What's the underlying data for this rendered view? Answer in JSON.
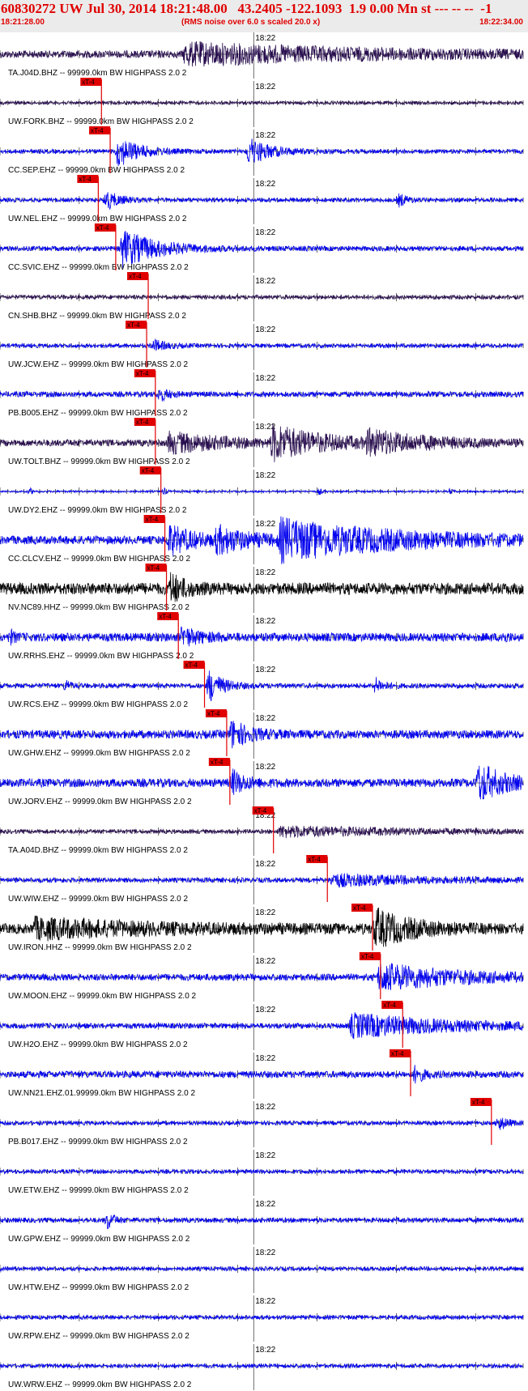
{
  "header": {
    "title": "60830272 UW Jul 30, 2014 18:21:48.00   43.2405 -122.1093  1.9 0.00 Mn st --- -- --  -1",
    "start_time": "18:21:28.00",
    "rms_note": "(RMS noise over 6.0 s scaled 20.0 x)",
    "end_time": "18:22:34.00"
  },
  "colors": {
    "header_text": "#e00000",
    "header_bg": "#ebebeb",
    "pick_marker": "#e00000",
    "trace_blue": "#0000ee",
    "trace_purple": "#2a1050",
    "trace_black": "#000000",
    "grid": "#000000"
  },
  "chart_data": {
    "type": "line",
    "x_unit": "seconds after 18:21:28.00",
    "xlim": [
      0,
      66
    ],
    "minute_mark_label": "18:22",
    "minute_mark_time": 32,
    "pick_label": "xT-4",
    "filter_text": "99999.0km BW  HIGHPASS  2.0  2",
    "grid": "vertical ticks every 1 s, every trace",
    "traces": [
      {
        "label": "TA.J04D.BHZ -- 99999.0km BW  HIGHPASS  2.0  2",
        "color": "purple",
        "pick": null,
        "base": 0.22,
        "bursts": [
          {
            "t": 23,
            "amp": 0.6,
            "dur": 42
          }
        ]
      },
      {
        "label": "UW.FORK.BHZ -- 99999.0km BW  HIGHPASS  2.0  2",
        "color": "purple",
        "pick": 12.8,
        "base": 0.1,
        "bursts": []
      },
      {
        "label": "CC.SEP.EHZ -- 99999.0km BW  HIGHPASS  2.0  2",
        "color": "blue",
        "pick": 13.9,
        "base": 0.12,
        "bursts": [
          {
            "t": 14.5,
            "amp": 1.0,
            "dur": 5
          },
          {
            "t": 31,
            "amp": 0.9,
            "dur": 5
          }
        ]
      },
      {
        "label": "UW.NEL.EHZ -- 99999.0km BW  HIGHPASS  2.0  2",
        "color": "blue",
        "pick": 12.4,
        "base": 0.12,
        "bursts": [
          {
            "t": 13,
            "amp": 0.7,
            "dur": 3
          },
          {
            "t": 50,
            "amp": 0.5,
            "dur": 2
          }
        ]
      },
      {
        "label": "CC.SVIC.EHZ -- 99999.0km BW  HIGHPASS  2.0  2",
        "color": "blue",
        "pick": 14.6,
        "base": 0.14,
        "bursts": [
          {
            "t": 15,
            "amp": 1.2,
            "dur": 8
          }
        ]
      },
      {
        "label": "CN.SHB.BHZ -- 99999.0km BW  HIGHPASS  2.0  2",
        "color": "purple",
        "pick": 18.7,
        "base": 0.12,
        "bursts": []
      },
      {
        "label": "UW.JCW.EHZ -- 99999.0km BW  HIGHPASS  2.0  2",
        "color": "blue",
        "pick": 18.5,
        "base": 0.12,
        "bursts": [
          {
            "t": 19,
            "amp": 0.4,
            "dur": 3
          }
        ]
      },
      {
        "label": "PB.B005.EHZ -- 99999.0km BW  HIGHPASS  2.0  2",
        "color": "blue",
        "pick": 19.6,
        "base": 0.16,
        "bursts": [
          {
            "t": 19.8,
            "amp": 0.5,
            "dur": 2
          }
        ]
      },
      {
        "label": "UW.TOLT.BHZ -- 99999.0km BW  HIGHPASS  2.0  2",
        "color": "purple",
        "pick": 19.6,
        "base": 0.2,
        "bursts": [
          {
            "t": 21,
            "amp": 0.6,
            "dur": 13
          },
          {
            "t": 34,
            "amp": 1.0,
            "dur": 12
          },
          {
            "t": 46,
            "amp": 0.6,
            "dur": 14
          }
        ]
      },
      {
        "label": "UW.DY2.EHZ -- 99999.0km BW  HIGHPASS  2.0  2",
        "color": "blue",
        "pick": 20.3,
        "base": 0.06,
        "bursts": [
          {
            "t": 3.5,
            "amp": 0.5,
            "dur": 0.6
          },
          {
            "t": 20.4,
            "amp": 0.5,
            "dur": 0.6
          },
          {
            "t": 40,
            "amp": 0.5,
            "dur": 0.6
          },
          {
            "t": 56.5,
            "amp": 0.4,
            "dur": 0.6
          }
        ]
      },
      {
        "label": "CC.CLCV.EHZ -- 99999.0km BW  HIGHPASS  2.0  2",
        "color": "blue",
        "pick": 20.8,
        "base": 0.25,
        "bursts": [
          {
            "t": 21,
            "amp": 0.9,
            "dur": 6
          },
          {
            "t": 27,
            "amp": 0.7,
            "dur": 8
          },
          {
            "t": 35,
            "amp": 1.1,
            "dur": 28
          }
        ]
      },
      {
        "label": "NV.NC89.HHZ -- 99999.0km BW  HIGHPASS  2.0  2",
        "color": "black",
        "pick": 21.0,
        "base": 0.35,
        "bursts": [
          {
            "t": 21.2,
            "amp": 1.0,
            "dur": 3
          }
        ]
      },
      {
        "label": "UW.RRHS.EHZ -- 99999.0km BW  HIGHPASS  2.0  2",
        "color": "blue",
        "pick": 22.5,
        "base": 0.25,
        "bursts": [
          {
            "t": 1,
            "amp": 0.6,
            "dur": 1
          },
          {
            "t": 22.6,
            "amp": 0.6,
            "dur": 4
          },
          {
            "t": 63,
            "amp": 0.5,
            "dur": 1
          }
        ]
      },
      {
        "label": "UW.RCS.EHZ -- 99999.0km BW  HIGHPASS  2.0  2",
        "color": "blue",
        "pick": 25.8,
        "base": 0.14,
        "bursts": [
          {
            "t": 8,
            "amp": 0.6,
            "dur": 1
          },
          {
            "t": 26,
            "amp": 1.2,
            "dur": 3
          },
          {
            "t": 47,
            "amp": 0.6,
            "dur": 2
          }
        ]
      },
      {
        "label": "UW.GHW.EHZ -- 99999.0km BW  HIGHPASS  2.0  2",
        "color": "blue",
        "pick": 28.6,
        "base": 0.25,
        "bursts": [
          {
            "t": 28.8,
            "amp": 0.9,
            "dur": 4
          }
        ]
      },
      {
        "label": "UW.JORV.EHZ -- 99999.0km BW  HIGHPASS  2.0  2",
        "color": "blue",
        "pick": 29.0,
        "base": 0.25,
        "bursts": [
          {
            "t": 29,
            "amp": 0.8,
            "dur": 3
          },
          {
            "t": 60,
            "amp": 1.2,
            "dur": 6
          }
        ]
      },
      {
        "label": "TA.A04D.BHZ -- 99999.0km BW  HIGHPASS  2.0  2",
        "color": "purple",
        "pick": 34.5,
        "base": 0.12,
        "bursts": [
          {
            "t": 35,
            "amp": 0.3,
            "dur": 30
          }
        ]
      },
      {
        "label": "UW.WIW.EHZ -- 99999.0km BW  HIGHPASS  2.0  2",
        "color": "blue",
        "pick": 41.3,
        "base": 0.14,
        "bursts": [
          {
            "t": 41.5,
            "amp": 0.35,
            "dur": 20
          }
        ]
      },
      {
        "label": "UW.IRON.HHZ -- 99999.0km BW  HIGHPASS  2.0  2",
        "color": "black",
        "pick": 47.0,
        "base": 0.3,
        "bursts": [
          {
            "t": 4,
            "amp": 0.5,
            "dur": 26
          },
          {
            "t": 47,
            "amp": 1.1,
            "dur": 8
          }
        ]
      },
      {
        "label": "UW.MOON.EHZ -- 99999.0km BW  HIGHPASS  2.0  2",
        "color": "blue",
        "pick": 48.0,
        "base": 0.2,
        "bursts": [
          {
            "t": 47.5,
            "amp": 0.8,
            "dur": 18
          }
        ]
      },
      {
        "label": "UW.H2O.EHZ -- 99999.0km BW  HIGHPASS  2.0  2",
        "color": "blue",
        "pick": 50.8,
        "base": 0.16,
        "bursts": [
          {
            "t": 44,
            "amp": 0.7,
            "dur": 22
          }
        ]
      },
      {
        "label": "UW.NN21.EHZ.01.99999.0km BW  HIGHPASS  2.0  2",
        "color": "blue",
        "pick": 51.8,
        "base": 0.2,
        "bursts": [
          {
            "t": 52,
            "amp": 0.6,
            "dur": 2
          }
        ]
      },
      {
        "label": "PB.B017.EHZ -- 99999.0km BW  HIGHPASS  2.0  2",
        "color": "blue",
        "pick": 62.0,
        "base": 0.12,
        "bursts": [
          {
            "t": 62.5,
            "amp": 0.6,
            "dur": 2
          }
        ]
      },
      {
        "label": "UW.ETW.EHZ -- 99999.0km BW  HIGHPASS  2.0  2",
        "color": "blue",
        "pick": null,
        "base": 0.12,
        "bursts": []
      },
      {
        "label": "UW.GPW.EHZ -- 99999.0km BW  HIGHPASS  2.0  2",
        "color": "blue",
        "pick": null,
        "base": 0.14,
        "bursts": [
          {
            "t": 13.2,
            "amp": 0.8,
            "dur": 1.5
          }
        ]
      },
      {
        "label": "UW.HTW.EHZ -- 99999.0km BW  HIGHPASS  2.0  2",
        "color": "blue",
        "pick": null,
        "base": 0.12,
        "bursts": []
      },
      {
        "label": "UW.RPW.EHZ -- 99999.0km BW  HIGHPASS  2.0  2",
        "color": "blue",
        "pick": null,
        "base": 0.12,
        "bursts": []
      },
      {
        "label": "UW.WRW.EHZ -- 99999.0km BW  HIGHPASS  2.0  2",
        "color": "blue",
        "pick": null,
        "base": 0.12,
        "bursts": []
      }
    ]
  }
}
